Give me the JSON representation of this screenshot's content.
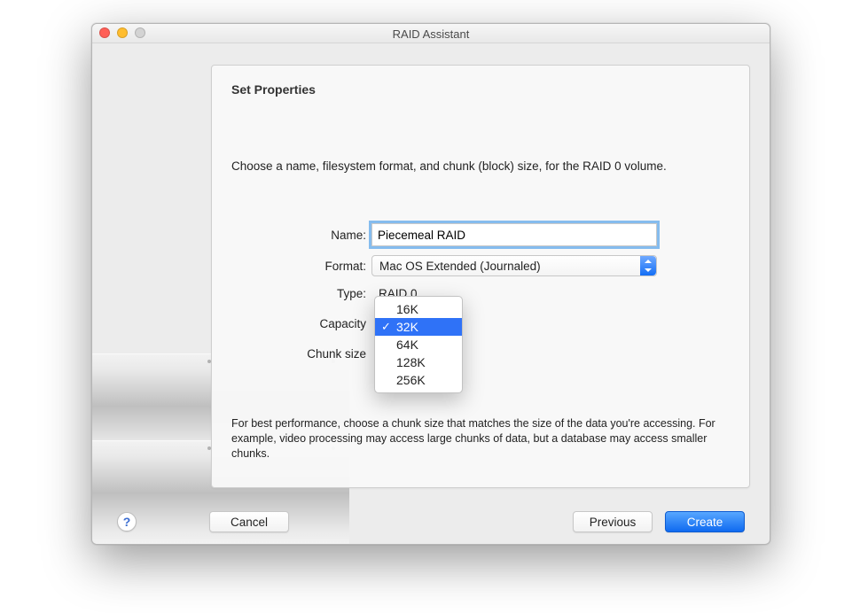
{
  "window": {
    "title": "RAID Assistant"
  },
  "heading": "Set Properties",
  "intro": "Choose a name, filesystem format, and chunk (block) size, for the RAID 0 volume.",
  "labels": {
    "name": "Name:",
    "format": "Format:",
    "type": "Type:",
    "capacity": "Capacity",
    "chunk": "Chunk size"
  },
  "values": {
    "name_input": "Piecemeal RAID",
    "format_selected": "Mac OS Extended (Journaled)",
    "type": "RAID 0"
  },
  "chunk_menu": {
    "options": [
      "16K",
      "32K",
      "64K",
      "128K",
      "256K"
    ],
    "selected": "32K"
  },
  "tip": "For best performance, choose a chunk size that matches the size of the data you're accessing. For example, video processing may access large chunks of data, but a database may access smaller chunks.",
  "buttons": {
    "help": "?",
    "cancel": "Cancel",
    "previous": "Previous",
    "create": "Create"
  }
}
